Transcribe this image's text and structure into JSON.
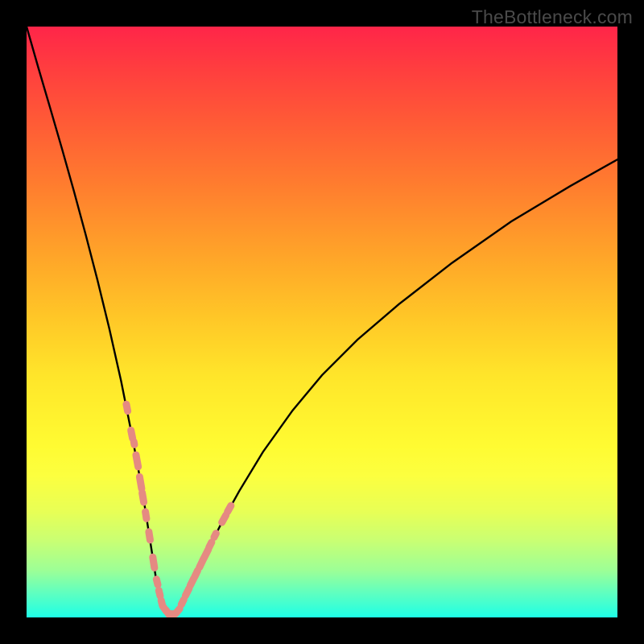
{
  "watermark": "TheBottleneck.com",
  "colors": {
    "curve_stroke": "#000000",
    "marker_fill": "#e58a82",
    "marker_stroke": "#e58a82"
  },
  "chart_data": {
    "type": "line",
    "title": "",
    "xlabel": "",
    "ylabel": "",
    "xlim": [
      0,
      100
    ],
    "ylim": [
      0,
      100
    ],
    "series": [
      {
        "name": "bottleneck-curve",
        "x": [
          0,
          2,
          4,
          6,
          8,
          10,
          12,
          14,
          16,
          18,
          19,
          20,
          21,
          22,
          23,
          24,
          25,
          26,
          28,
          30,
          33,
          36,
          40,
          45,
          50,
          56,
          63,
          72,
          82,
          92,
          100
        ],
        "y": [
          100,
          93,
          86.2,
          79.3,
          72.2,
          64.8,
          57.1,
          48.9,
          40.0,
          30.0,
          24.6,
          18.8,
          12.4,
          6.0,
          2.0,
          0.6,
          0.6,
          1.8,
          5.8,
          10.0,
          16.0,
          21.4,
          28.0,
          35.0,
          41.0,
          47.0,
          53.0,
          60.0,
          67.0,
          73.0,
          77.5
        ]
      }
    ],
    "markers": [
      {
        "x": 17.0,
        "y": 35.5,
        "size": 1.1
      },
      {
        "x": 17.8,
        "y": 31.0,
        "size": 1.2
      },
      {
        "x": 18.2,
        "y": 29.5,
        "size": 0.8
      },
      {
        "x": 18.7,
        "y": 26.5,
        "size": 1.5
      },
      {
        "x": 19.3,
        "y": 22.8,
        "size": 1.5
      },
      {
        "x": 19.7,
        "y": 20.3,
        "size": 1.3
      },
      {
        "x": 20.2,
        "y": 17.3,
        "size": 1.1
      },
      {
        "x": 20.8,
        "y": 13.8,
        "size": 1.2
      },
      {
        "x": 21.5,
        "y": 9.3,
        "size": 1.4
      },
      {
        "x": 22.1,
        "y": 6.0,
        "size": 1.0
      },
      {
        "x": 22.5,
        "y": 4.1,
        "size": 1.0
      },
      {
        "x": 22.9,
        "y": 2.4,
        "size": 1.0
      },
      {
        "x": 23.4,
        "y": 1.4,
        "size": 1.0
      },
      {
        "x": 23.9,
        "y": 0.8,
        "size": 1.1
      },
      {
        "x": 24.6,
        "y": 0.6,
        "size": 1.1
      },
      {
        "x": 25.6,
        "y": 1.1,
        "size": 1.0
      },
      {
        "x": 26.4,
        "y": 2.6,
        "size": 1.0
      },
      {
        "x": 27.2,
        "y": 4.3,
        "size": 1.2
      },
      {
        "x": 28.0,
        "y": 6.0,
        "size": 1.2
      },
      {
        "x": 28.7,
        "y": 7.4,
        "size": 1.1
      },
      {
        "x": 29.6,
        "y": 9.2,
        "size": 1.3
      },
      {
        "x": 30.4,
        "y": 10.8,
        "size": 1.3
      },
      {
        "x": 31.1,
        "y": 12.3,
        "size": 1.0
      },
      {
        "x": 31.9,
        "y": 13.9,
        "size": 0.9
      },
      {
        "x": 33.4,
        "y": 16.7,
        "size": 1.2
      },
      {
        "x": 34.3,
        "y": 18.4,
        "size": 1.1
      }
    ]
  }
}
